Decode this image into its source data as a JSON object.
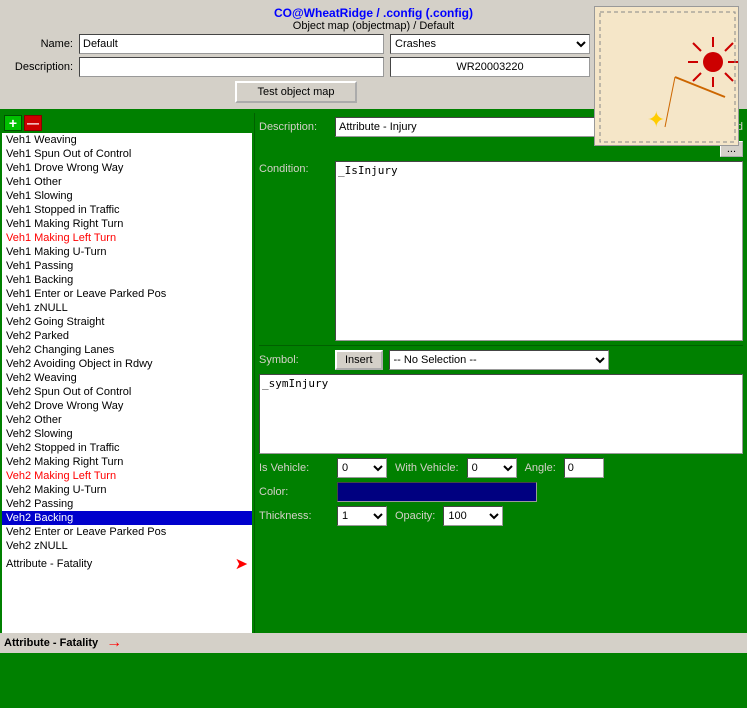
{
  "header": {
    "title_link": "CO@WheatRidge / .config (.config)",
    "subtitle": "Object map (objectmap) / Default",
    "name_label": "Name:",
    "name_value": "Default",
    "crashes_options": [
      "Crashes"
    ],
    "crashes_selected": "Crashes",
    "wr_value": "WR20003220",
    "desc_label": "Description:",
    "desc_value": "",
    "test_btn_label": "Test object map"
  },
  "list": {
    "add_btn": "+",
    "remove_btn": "—",
    "items": [
      "Veh1 Weaving",
      "Veh1 Spun Out of Control",
      "Veh1 Drove Wrong Way",
      "Veh1 Other",
      "Veh1 Slowing",
      "Veh1 Stopped in Traffic",
      "Veh1 Making Right Turn",
      "Veh1 Making Left Turn",
      "Veh1 Making U-Turn",
      "Veh1 Passing",
      "Veh1 Backing",
      "Veh1 Enter or Leave Parked Pos",
      "Veh1 zNULL",
      "Veh2 Going Straight",
      "Veh2 Parked",
      "Veh2 Changing Lanes",
      "Veh2 Avoiding Object in Rdwy",
      "Veh2 Weaving",
      "Veh2 Spun Out of Control",
      "Veh2 Drove Wrong Way",
      "Veh2 Other",
      "Veh2 Slowing",
      "Veh2 Stopped in Traffic",
      "Veh2 Making Right Turn",
      "Veh2 Making Left Turn",
      "Veh2 Making U-Turn",
      "Veh2 Passing",
      "Veh2 Backing",
      "Veh2 Enter or Leave Parked Pos",
      "Veh2 zNULL",
      "Attribute - Fatality"
    ],
    "selected_index": 27
  },
  "right_panel": {
    "desc_label": "Description:",
    "desc_value": "Attribute - Injury",
    "enabled_label": "Enabled",
    "dots_btn": "...",
    "condition_label": "Condition:",
    "condition_value": "_IsInjury",
    "symbol_label": "Symbol:",
    "insert_btn": "Insert",
    "no_selection": "-- No Selection --",
    "symbol_options": [
      "-- No Selection --"
    ],
    "symbol_value": "_symInjury",
    "is_vehicle_label": "Is Vehicle:",
    "is_vehicle_value": "0",
    "with_vehicle_label": "With Vehicle:",
    "with_vehicle_value": "0",
    "angle_label": "Angle:",
    "angle_value": "0",
    "color_label": "Color:",
    "color_value": "#000080",
    "thickness_label": "Thickness:",
    "thickness_value": "1",
    "opacity_label": "Opacity:",
    "opacity_value": "100"
  }
}
